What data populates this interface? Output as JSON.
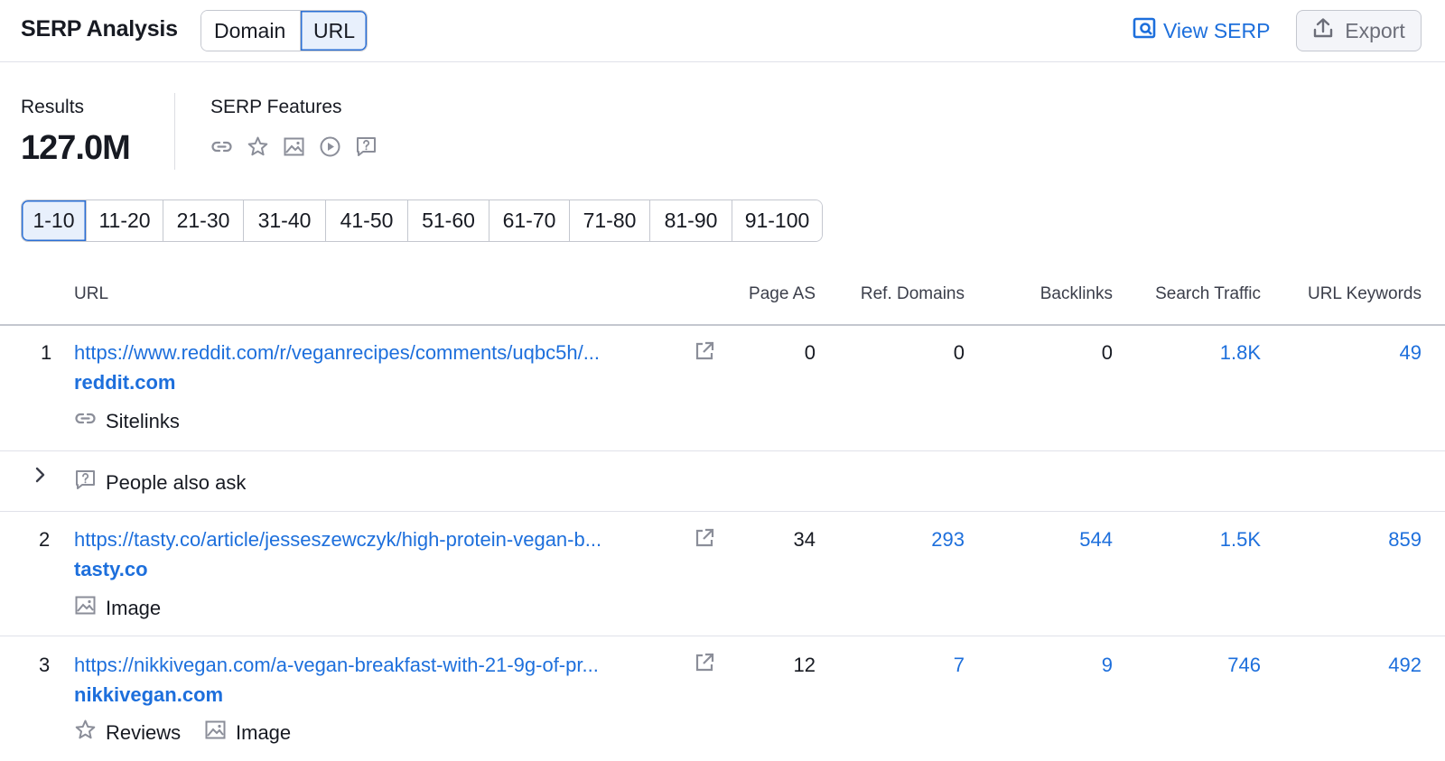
{
  "header": {
    "title": "SERP Analysis",
    "toggle": [
      "Domain",
      "URL"
    ],
    "view_serp": "View SERP",
    "export": "Export"
  },
  "summary": {
    "results_label": "Results",
    "results_value": "127.0M",
    "features_label": "SERP Features",
    "feature_icons": [
      "link-icon",
      "star-icon",
      "image-icon",
      "video-icon",
      "question-icon"
    ]
  },
  "pagination": [
    "1-10",
    "11-20",
    "21-30",
    "31-40",
    "41-50",
    "51-60",
    "61-70",
    "71-80",
    "81-90",
    "91-100"
  ],
  "columns": {
    "url": "URL",
    "page_as": "Page AS",
    "ref_domains": "Ref. Domains",
    "backlinks": "Backlinks",
    "search_traffic": "Search Traffic",
    "url_keywords": "URL Keywords"
  },
  "rows": [
    {
      "num": "1",
      "url": "https://www.reddit.com/r/veganrecipes/comments/uqbc5h/...",
      "domain": "reddit.com",
      "page_as": "0",
      "ref_domains": "0",
      "backlinks": "0",
      "search_traffic": "1.8K",
      "url_keywords": "49",
      "features": [
        "Sitelinks"
      ]
    },
    {
      "paa_label": "People also ask"
    },
    {
      "num": "2",
      "url": "https://tasty.co/article/jesseszewczyk/high-protein-vegan-b...",
      "domain": "tasty.co",
      "page_as": "34",
      "ref_domains": "293",
      "backlinks": "544",
      "search_traffic": "1.5K",
      "url_keywords": "859",
      "features": [
        "Image"
      ]
    },
    {
      "num": "3",
      "url": "https://nikkivegan.com/a-vegan-breakfast-with-21-9g-of-pr...",
      "domain": "nikkivegan.com",
      "page_as": "12",
      "ref_domains": "7",
      "backlinks": "9",
      "search_traffic": "746",
      "url_keywords": "492",
      "features": [
        "Reviews",
        "Image"
      ]
    }
  ],
  "colors": {
    "link": "#1d6fdc",
    "active_bg": "#e8f0fc",
    "active_border": "#2b6fd4",
    "border": "#c4c7cf",
    "icon_gray": "#8b8e99"
  }
}
